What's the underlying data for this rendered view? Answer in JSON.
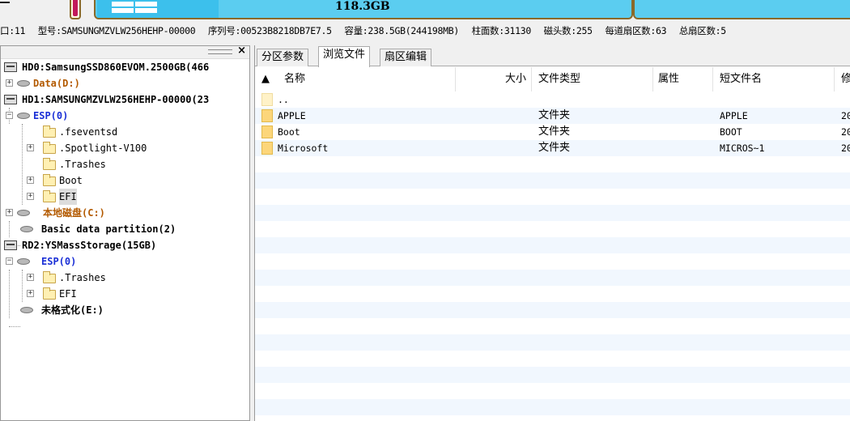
{
  "diskbar": {
    "capacity_label": "118.3GB"
  },
  "infoline": {
    "items": [
      "口:11",
      "型号:SAMSUNGMZVLW256HEHP-00000",
      "序列号:00523B8218DB7E7.5",
      "容量:238.5GB(244198MB)",
      "柱面数:31130",
      "磁头数:255",
      "每道扇区数:63",
      "总扇区数:5"
    ]
  },
  "tree": {
    "hd0": "HD0:SamsungSSD860EVOM.2500GB(466",
    "hd0_data": "Data(D:)",
    "hd1": "HD1:SAMSUNGMZVLW256HEHP-00000(23",
    "hd1_esp": "ESP(0)",
    "fseventsd": ".fseventsd",
    "spotlight": ".Spotlight-V100",
    "trashes": ".Trashes",
    "boot": "Boot",
    "efi": "EFI",
    "local_disk": "本地磁盘(C:)",
    "basic_data": "Basic data partition(2)",
    "rd2": "RD2:YSMassStorage(15GB)",
    "rd2_esp": "ESP(0)",
    "rd2_trashes": ".Trashes",
    "rd2_efi": "EFI",
    "unformatted": "未格式化(E:)"
  },
  "tabs": [
    "分区参数",
    "浏览文件",
    "扇区编辑"
  ],
  "grid": {
    "columns": {
      "name": "名称",
      "size": "大小",
      "type": "文件类型",
      "attr": "属性",
      "short": "短文件名",
      "modified": "修"
    },
    "rows": [
      {
        "name": "..",
        "type": "",
        "short": "",
        "date": ""
      },
      {
        "name": "APPLE",
        "type": "文件夹",
        "short": "APPLE",
        "date": "20"
      },
      {
        "name": "Boot",
        "type": "文件夹",
        "short": "BOOT",
        "date": "20"
      },
      {
        "name": "Microsoft",
        "type": "文件夹",
        "short": "MICROS~1",
        "date": "20"
      }
    ]
  },
  "colors": {
    "partition_fill": "#5bcdf0",
    "partition_border": "#8a6a2a",
    "tree_volume_blue": "#1a2fd6",
    "tree_volume_orange": "#b35a00",
    "row_stripe": "#f1f7fe"
  }
}
